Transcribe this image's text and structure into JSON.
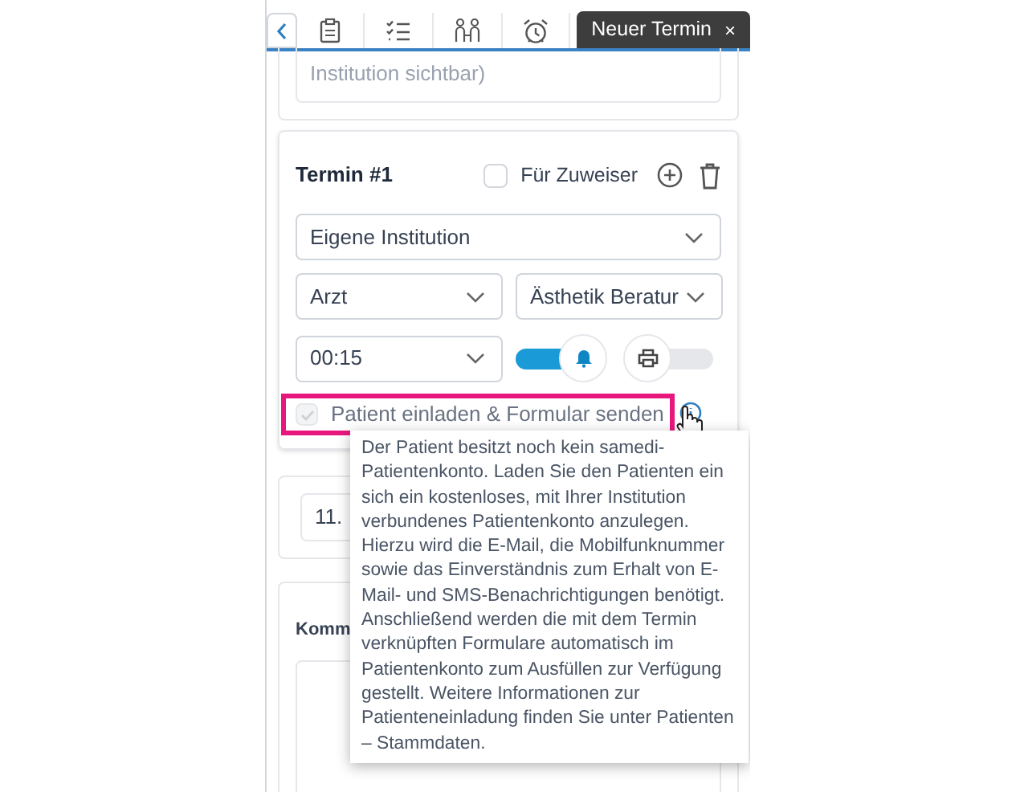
{
  "tabs": [
    {
      "kind": "back",
      "selected": false
    },
    {
      "kind": "clipboard",
      "selected": false
    },
    {
      "kind": "checklist",
      "selected": false
    },
    {
      "kind": "people",
      "selected": false
    },
    {
      "kind": "alarm",
      "selected": false
    },
    {
      "kind": "label",
      "label": "Neuer Termin",
      "close": "×",
      "selected": true
    }
  ],
  "comment_card": {
    "placeholder": "Institution sichtbar)"
  },
  "appointment": {
    "title": "Termin #1",
    "referrer": {
      "label": "Für Zuweiser",
      "checked": false
    },
    "institution": "Eigene Institution",
    "role": "Arzt",
    "service": "Ästhetik Beratur",
    "duration": "00:15",
    "reminder": {
      "on": true
    },
    "print": {
      "on": false
    },
    "invite": {
      "label": "Patient einladen & Formular senden",
      "checked": true,
      "disabled": true,
      "highlighted": true
    }
  },
  "date_card": {
    "value": "11."
  },
  "notes_card": {
    "label": "Komm"
  },
  "tooltip": {
    "text": "Der Patient besitzt noch kein samedi-Patientenkonto. Laden Sie den Patienten ein sich ein kostenloses, mit Ihrer Institution verbundenes Patientenkonto anzulegen. Hierzu wird die E-Mail, die Mobilfunknummer sowie das Einverständnis zum Erhalt von E-Mail- und SMS-Benachrichtigungen benötigt. Anschließend werden die mit dem Termin verknüpften Formulare automatisch im Patientenkonto zum Ausfüllen zur Verfügung gestellt. Weitere Informationen zur Patienteneinladung finden Sie unter Patienten – Stammdaten."
  }
}
